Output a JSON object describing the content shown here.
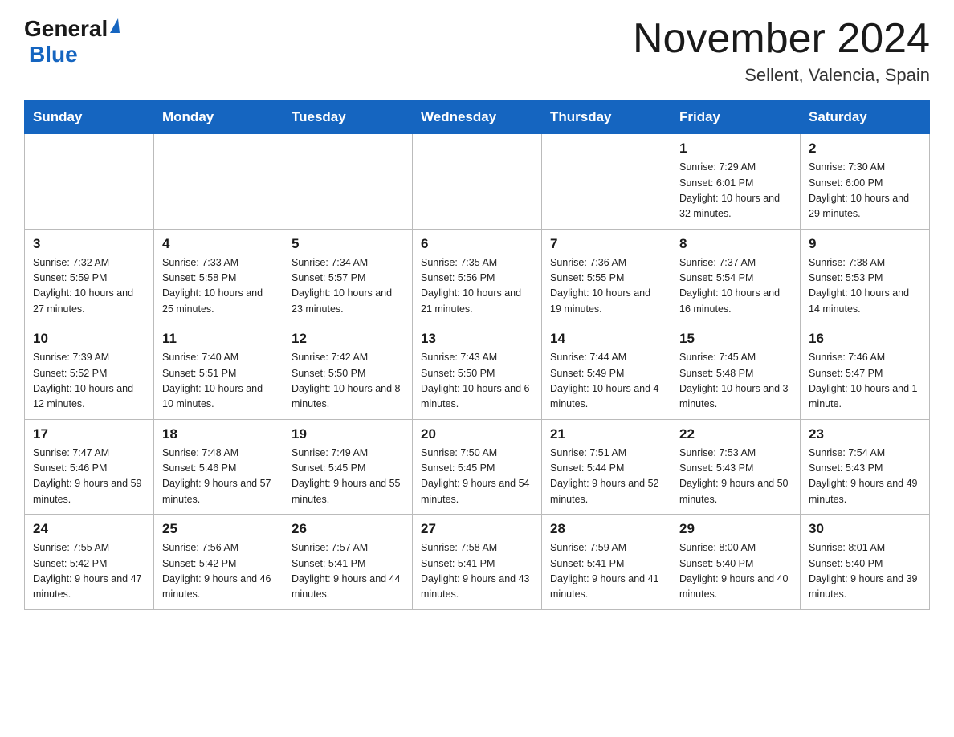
{
  "header": {
    "title": "November 2024",
    "location": "Sellent, Valencia, Spain",
    "logo_general": "General",
    "logo_blue": "Blue"
  },
  "weekdays": [
    "Sunday",
    "Monday",
    "Tuesday",
    "Wednesday",
    "Thursday",
    "Friday",
    "Saturday"
  ],
  "weeks": [
    {
      "days": [
        {
          "num": "",
          "info": ""
        },
        {
          "num": "",
          "info": ""
        },
        {
          "num": "",
          "info": ""
        },
        {
          "num": "",
          "info": ""
        },
        {
          "num": "",
          "info": ""
        },
        {
          "num": "1",
          "info": "Sunrise: 7:29 AM\nSunset: 6:01 PM\nDaylight: 10 hours\nand 32 minutes."
        },
        {
          "num": "2",
          "info": "Sunrise: 7:30 AM\nSunset: 6:00 PM\nDaylight: 10 hours\nand 29 minutes."
        }
      ]
    },
    {
      "days": [
        {
          "num": "3",
          "info": "Sunrise: 7:32 AM\nSunset: 5:59 PM\nDaylight: 10 hours\nand 27 minutes."
        },
        {
          "num": "4",
          "info": "Sunrise: 7:33 AM\nSunset: 5:58 PM\nDaylight: 10 hours\nand 25 minutes."
        },
        {
          "num": "5",
          "info": "Sunrise: 7:34 AM\nSunset: 5:57 PM\nDaylight: 10 hours\nand 23 minutes."
        },
        {
          "num": "6",
          "info": "Sunrise: 7:35 AM\nSunset: 5:56 PM\nDaylight: 10 hours\nand 21 minutes."
        },
        {
          "num": "7",
          "info": "Sunrise: 7:36 AM\nSunset: 5:55 PM\nDaylight: 10 hours\nand 19 minutes."
        },
        {
          "num": "8",
          "info": "Sunrise: 7:37 AM\nSunset: 5:54 PM\nDaylight: 10 hours\nand 16 minutes."
        },
        {
          "num": "9",
          "info": "Sunrise: 7:38 AM\nSunset: 5:53 PM\nDaylight: 10 hours\nand 14 minutes."
        }
      ]
    },
    {
      "days": [
        {
          "num": "10",
          "info": "Sunrise: 7:39 AM\nSunset: 5:52 PM\nDaylight: 10 hours\nand 12 minutes."
        },
        {
          "num": "11",
          "info": "Sunrise: 7:40 AM\nSunset: 5:51 PM\nDaylight: 10 hours\nand 10 minutes."
        },
        {
          "num": "12",
          "info": "Sunrise: 7:42 AM\nSunset: 5:50 PM\nDaylight: 10 hours\nand 8 minutes."
        },
        {
          "num": "13",
          "info": "Sunrise: 7:43 AM\nSunset: 5:50 PM\nDaylight: 10 hours\nand 6 minutes."
        },
        {
          "num": "14",
          "info": "Sunrise: 7:44 AM\nSunset: 5:49 PM\nDaylight: 10 hours\nand 4 minutes."
        },
        {
          "num": "15",
          "info": "Sunrise: 7:45 AM\nSunset: 5:48 PM\nDaylight: 10 hours\nand 3 minutes."
        },
        {
          "num": "16",
          "info": "Sunrise: 7:46 AM\nSunset: 5:47 PM\nDaylight: 10 hours\nand 1 minute."
        }
      ]
    },
    {
      "days": [
        {
          "num": "17",
          "info": "Sunrise: 7:47 AM\nSunset: 5:46 PM\nDaylight: 9 hours\nand 59 minutes."
        },
        {
          "num": "18",
          "info": "Sunrise: 7:48 AM\nSunset: 5:46 PM\nDaylight: 9 hours\nand 57 minutes."
        },
        {
          "num": "19",
          "info": "Sunrise: 7:49 AM\nSunset: 5:45 PM\nDaylight: 9 hours\nand 55 minutes."
        },
        {
          "num": "20",
          "info": "Sunrise: 7:50 AM\nSunset: 5:45 PM\nDaylight: 9 hours\nand 54 minutes."
        },
        {
          "num": "21",
          "info": "Sunrise: 7:51 AM\nSunset: 5:44 PM\nDaylight: 9 hours\nand 52 minutes."
        },
        {
          "num": "22",
          "info": "Sunrise: 7:53 AM\nSunset: 5:43 PM\nDaylight: 9 hours\nand 50 minutes."
        },
        {
          "num": "23",
          "info": "Sunrise: 7:54 AM\nSunset: 5:43 PM\nDaylight: 9 hours\nand 49 minutes."
        }
      ]
    },
    {
      "days": [
        {
          "num": "24",
          "info": "Sunrise: 7:55 AM\nSunset: 5:42 PM\nDaylight: 9 hours\nand 47 minutes."
        },
        {
          "num": "25",
          "info": "Sunrise: 7:56 AM\nSunset: 5:42 PM\nDaylight: 9 hours\nand 46 minutes."
        },
        {
          "num": "26",
          "info": "Sunrise: 7:57 AM\nSunset: 5:41 PM\nDaylight: 9 hours\nand 44 minutes."
        },
        {
          "num": "27",
          "info": "Sunrise: 7:58 AM\nSunset: 5:41 PM\nDaylight: 9 hours\nand 43 minutes."
        },
        {
          "num": "28",
          "info": "Sunrise: 7:59 AM\nSunset: 5:41 PM\nDaylight: 9 hours\nand 41 minutes."
        },
        {
          "num": "29",
          "info": "Sunrise: 8:00 AM\nSunset: 5:40 PM\nDaylight: 9 hours\nand 40 minutes."
        },
        {
          "num": "30",
          "info": "Sunrise: 8:01 AM\nSunset: 5:40 PM\nDaylight: 9 hours\nand 39 minutes."
        }
      ]
    }
  ]
}
